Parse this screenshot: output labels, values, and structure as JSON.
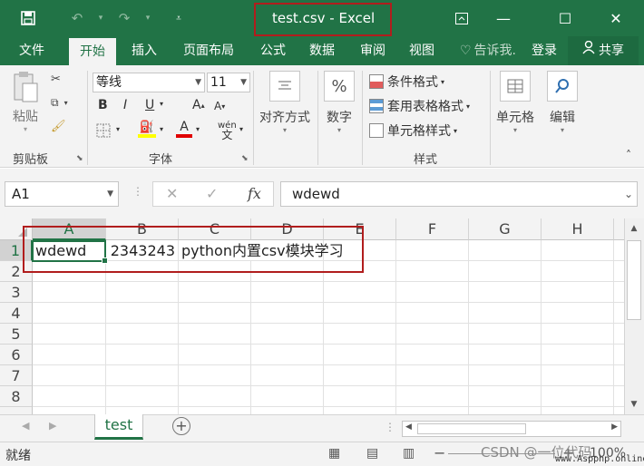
{
  "window": {
    "title": "test.csv - Excel"
  },
  "tabs": [
    "文件",
    "开始",
    "插入",
    "页面布局",
    "公式",
    "数据",
    "审阅",
    "视图"
  ],
  "tell_me": "告诉我.",
  "login": "登录",
  "share": "共享",
  "ribbon": {
    "paste": "粘贴",
    "clipboard": "剪贴板",
    "font_name": "等线",
    "font_size": "11",
    "font_group": "字体",
    "alignment": "对齐方式",
    "number": "数字",
    "number_icon": "%",
    "conditional_format": "条件格式",
    "table_format": "套用表格格式",
    "cell_style": "单元格样式",
    "styles_group": "样式",
    "cells": "单元格",
    "editing": "编辑",
    "bold": "B",
    "italic": "I",
    "underline": "U",
    "grow_font": "A",
    "shrink_font": "A",
    "wen": "wén",
    "font_color_letter": "A"
  },
  "formula_bar": {
    "name_box": "A1",
    "content": "wdewd",
    "fx": "fx"
  },
  "grid": {
    "columns": [
      "A",
      "B",
      "C",
      "D",
      "E",
      "F",
      "G",
      "H"
    ],
    "rows": [
      "1",
      "2",
      "3",
      "4",
      "5",
      "6",
      "7",
      "8"
    ],
    "cells": {
      "A1": "wdewd",
      "B1": "2343243",
      "C1": "python内置csv模块学习"
    }
  },
  "sheets": [
    "test"
  ],
  "status": {
    "ready": "就绪",
    "zoom": "100%",
    "watermark": "CSDN @一位代码",
    "watermark_site": "www.Aspphp.online"
  },
  "colors": {
    "excel_green": "#217346",
    "highlight_red": "#b11d1d"
  }
}
